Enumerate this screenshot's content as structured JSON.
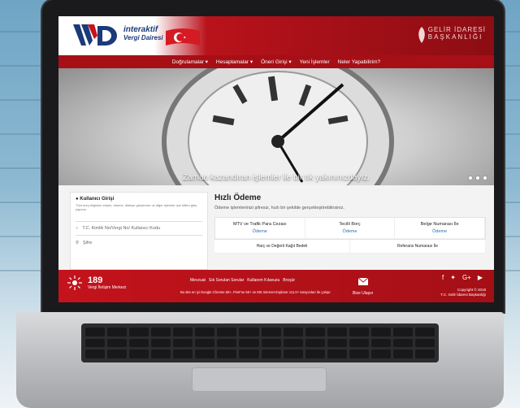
{
  "header": {
    "logo_line1": "interaktif",
    "logo_line2": "Vergi Dairesi",
    "gib_line1": "GELİR İDARESİ",
    "gib_line2": "BAŞKANLIĞI"
  },
  "nav": {
    "items": [
      {
        "label": "Doğrulamalar ▾"
      },
      {
        "label": "Hesaplamalar ▾"
      },
      {
        "label": "Öneri Girişi ▾"
      },
      {
        "label": "Yeni İşlemler"
      },
      {
        "label": "Neler Yapabilirim?"
      }
    ]
  },
  "hero": {
    "caption": "Zaman kazandıran işlemler ile bir tık yakınınızdayız."
  },
  "login": {
    "title": "Kullanıcı Girişi",
    "description": "Tüm borç bilgisine erişim, ödeme, dilekçe gönderme ve diğer işlemler için lütfen giriş yapınız.",
    "id_placeholder": "T.C. Kimlik No/Vergi No/ Kullanıcı Kodu",
    "password_placeholder": "Şifre"
  },
  "quick_pay": {
    "title": "Hızlı Ödeme",
    "subtitle": "Ödeme işlemlerinizi şifresiz, hızlı bir şekilde gerçekleştirebilirsiniz.",
    "items": [
      {
        "name": "MTV ve Trafik Para Cezası",
        "action": "Ödeme"
      },
      {
        "name": "Tecilli Borç",
        "action": "Ödeme"
      },
      {
        "name": "Belge Numarası İle",
        "action": "Ödeme"
      }
    ],
    "items_row2": [
      {
        "name": "Harç ve Değerli Kağıt Bedeli"
      },
      {
        "name": "Referans Numarası İle"
      }
    ]
  },
  "footer": {
    "call_number": "189",
    "call_label": "Vergi İletişim Merkezi",
    "links": [
      "Mevzuat",
      "Sık Sorulan Sorular",
      "Kullanım Kılavuzu",
      "Broşür"
    ],
    "browser_note": "Bu site en iyi Google Chrome 50+, FireFox 50+ ve MS Internet Explorer v11.0+ tarayıcıları ile çalışır.",
    "contact_label": "Bize Ulaşın",
    "copyright_line1": "Copyright © 2018",
    "copyright_line2": "T.C. Gelir İdaresi Başkanlığı"
  },
  "colors": {
    "brand_red": "#b9121b",
    "nav_red": "#a70f17",
    "link_blue": "#2a6fb5",
    "logo_blue": "#1b3a7a"
  }
}
